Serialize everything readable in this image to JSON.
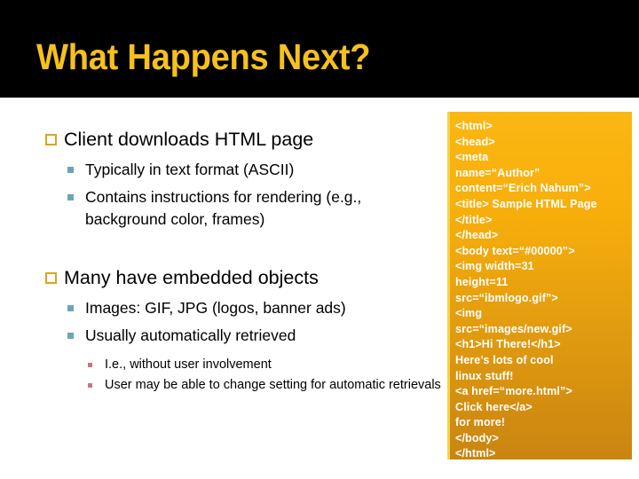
{
  "slide": {
    "title": "What Happens Next?",
    "title_color": "#f6c01e",
    "title_band_color": "#000000",
    "background_color": "#ffffff"
  },
  "content": {
    "groups": [
      {
        "heading": "Client downloads HTML page",
        "sub": [
          {
            "text": "Typically in text format (ASCII)",
            "children": []
          },
          {
            "text": "Contains instructions for rendering  (e.g., background color, frames)",
            "children": []
          }
        ]
      },
      {
        "heading": "Many have embedded objects",
        "sub": [
          {
            "text": "Images: GIF, JPG (logos, banner ads)",
            "children": []
          },
          {
            "text": "Usually automatically retrieved",
            "children": [
              "I.e., without user involvement",
              "User may be able to change setting for automatic retrievals"
            ]
          }
        ]
      }
    ],
    "marker_colors": {
      "level1": "#d9a520",
      "level2": "#6fa3ba",
      "level3": "#c1797f"
    }
  },
  "code_panel": {
    "text_color": "#ffffff",
    "accent_top": "#fbb713",
    "accent_bottom": "#c98511",
    "border_color": "#f7d24a",
    "lines": [
      "<html>",
      "<head>",
      "<meta",
      "name=“Author”",
      "content=“Erich Nahum”>",
      "<title> Sample HTML Page",
      "</title>",
      "</head>",
      "<body text=“#00000”>",
      "<img width=31",
      "height=11",
      "src=“ibmlogo.gif”>",
      "<img",
      "src=“images/new.gif>",
      "<h1>Hi There!</h1>",
      "Here’s lots of cool",
      "linux stuff!",
      "<a href=“more.html”>",
      "Click here</a>",
      "for more!",
      "</body>",
      "</html>"
    ]
  }
}
